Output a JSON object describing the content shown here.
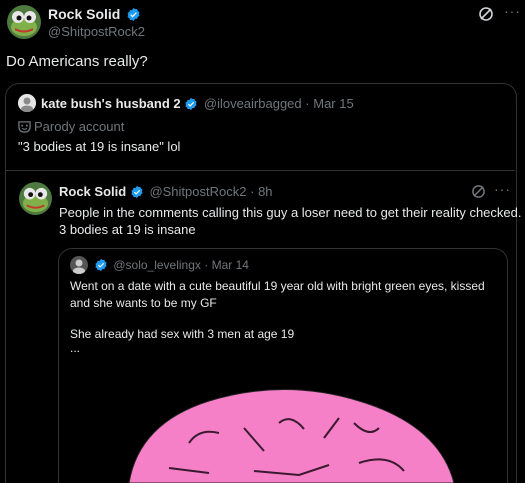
{
  "main_post": {
    "display_name": "Rock Solid",
    "handle": "@ShitpostRock2",
    "text": "Do Americans really?"
  },
  "quoted_post": {
    "display_name": "kate bush's husband 2",
    "handle": "@iloveairbagged",
    "separator": "·",
    "date": "Mar 15",
    "label": "Parody account",
    "text": "\"3 bodies at 19 is insane\" lol"
  },
  "thread_post": {
    "display_name": "Rock Solid",
    "handle": "@ShitpostRock2",
    "separator": "·",
    "time": "8h",
    "text_line1": "People in the comments calling this guy a loser need to get their reality checked.",
    "text_line2": "3 bodies at 19 is insane"
  },
  "inner_quote": {
    "handle": "@solo_levelingx",
    "separator": "·",
    "date": "Mar 14",
    "text_line1": "Went on a date with a cute beautiful 19 year old with bright green eyes, kissed",
    "text_line2": "and she wants to be my GF",
    "text_line3": "She already had sex with 3 men at age 19",
    "text_line4": "..."
  },
  "colors": {
    "background": "#000000",
    "text": "#e7e9ea",
    "muted": "#71767b",
    "border": "#2f3336",
    "verified_blue": "#1d9bf0",
    "brain_pink": "#f580c8"
  },
  "icons": [
    "verified-badge-icon",
    "grok-icon",
    "more-icon",
    "parody-mask-icon",
    "brain-image"
  ]
}
